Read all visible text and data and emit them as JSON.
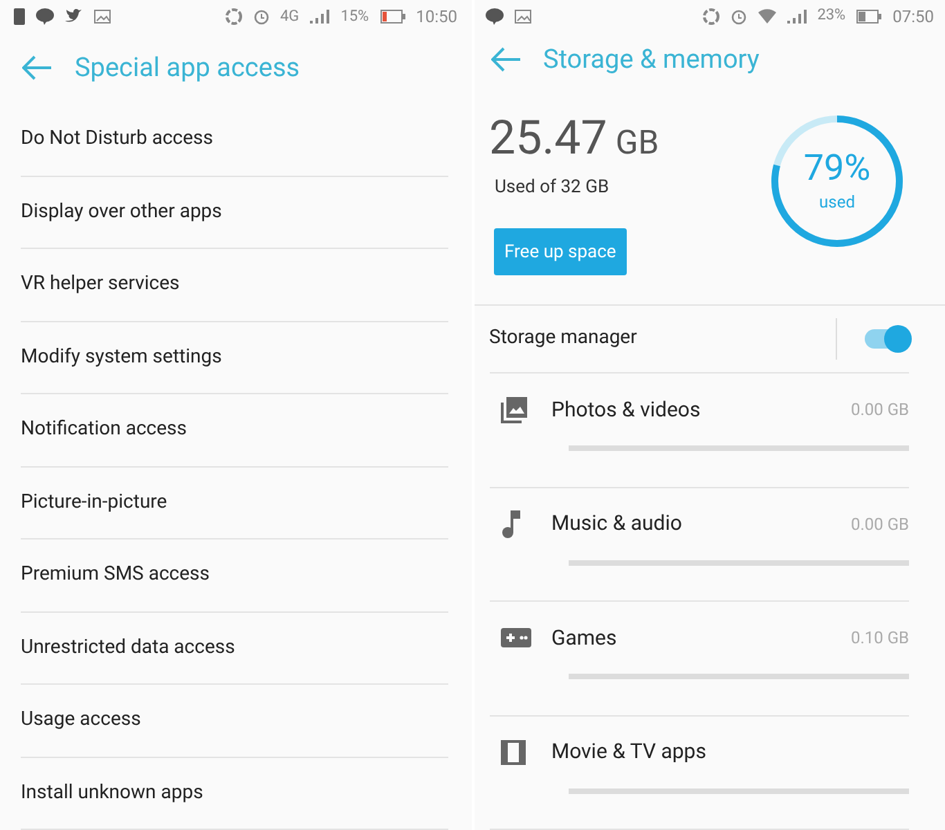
{
  "left": {
    "status_bar": {
      "network": "4G",
      "battery": "15%",
      "time": "10:50"
    },
    "title": "Special app access",
    "items": [
      {
        "label": "Do Not Disturb access"
      },
      {
        "label": "Display over other apps"
      },
      {
        "label": "VR helper services"
      },
      {
        "label": "Modify system settings"
      },
      {
        "label": "Notification access"
      },
      {
        "label": "Picture-in-picture"
      },
      {
        "label": "Premium SMS access"
      },
      {
        "label": "Unrestricted data access"
      },
      {
        "label": "Usage access"
      },
      {
        "label": "Install unknown apps"
      }
    ]
  },
  "right": {
    "status_bar": {
      "battery": "23%",
      "time": "07:50"
    },
    "title": "Storage & memory",
    "used_amount": "25.47",
    "used_unit": "GB",
    "used_of": "Used of 32 GB",
    "free_button": "Free up space",
    "gauge": {
      "percent": "79%",
      "caption": "used",
      "level": 0.79
    },
    "storage_manager": {
      "label": "Storage manager",
      "on": true
    },
    "categories": [
      {
        "kind": "photos",
        "label": "Photos & videos",
        "size": "0.00 GB"
      },
      {
        "kind": "music",
        "label": "Music & audio",
        "size": "0.00 GB"
      },
      {
        "kind": "games",
        "label": "Games",
        "size": "0.10 GB"
      },
      {
        "kind": "movies",
        "label": "Movie & TV apps"
      }
    ]
  }
}
